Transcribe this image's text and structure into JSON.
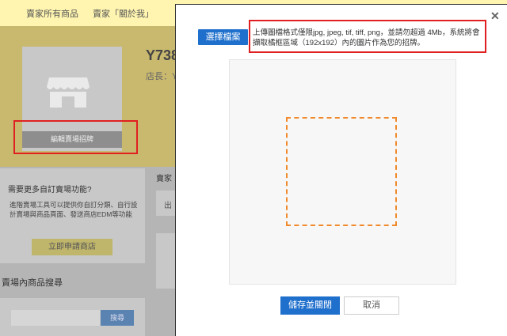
{
  "nav": {
    "all_products": "賣家所有商品",
    "about_seller": "賣家「關於我」"
  },
  "store": {
    "title": "Y738",
    "owner": "店長：Y",
    "edit_sign_label": "編輯賣場招牌"
  },
  "side": {
    "question": "需要更多自訂賣場功能?",
    "description": "進階賣場工具可以提供你自訂分類、自行設計賣場與商品頁面、發送商店EDM等功能",
    "apply_label": "立即申請商店"
  },
  "search": {
    "title": "賣場內商品搜尋",
    "button_label": "搜尋",
    "placeholder": ""
  },
  "right": {
    "label": "賣家",
    "item": "出"
  },
  "modal": {
    "close_label": "✕",
    "choose_file_label": "選擇檔案",
    "hint": "上傳圖檔格式僅限jpg, jpeg, tif, tiff, png，並請勿超過 4Mb，系統將會擷取橘框區域（192x192）內的圖片作為您的招牌。",
    "save_label": "儲存並關閉",
    "cancel_label": "取消"
  },
  "colors": {
    "accent_blue": "#1f6fcc",
    "highlight_red": "#e02020",
    "crop_orange": "#f08a2a"
  }
}
